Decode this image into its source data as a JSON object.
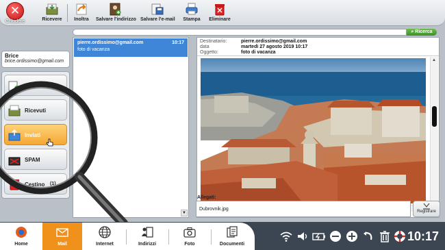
{
  "toolbar": {
    "close_label": "Chiudere",
    "buttons": [
      {
        "label": "Ricevere"
      },
      {
        "label": "Inoltra"
      },
      {
        "label": "Salvare l'indirizzo"
      },
      {
        "label": "Salvare l'e-mail"
      },
      {
        "label": "Stampa"
      },
      {
        "label": "Eliminare"
      }
    ]
  },
  "search": {
    "button_label": "Ricerca"
  },
  "user": {
    "name": "Brice",
    "email": "brice.ordissimo@gmail.com"
  },
  "folders": [
    {
      "label": "Scrivere",
      "icon": "compose-icon"
    },
    {
      "label": "Ricevuti",
      "icon": "inbox-icon"
    },
    {
      "label": "Inviati",
      "icon": "sent-icon"
    },
    {
      "label": "SPAM",
      "icon": "spam-icon"
    },
    {
      "label": "Cestino",
      "icon": "trash-icon",
      "count": "(1)"
    }
  ],
  "active_folder": "Inviati",
  "message_list": [
    {
      "from": "pierre.ordissimo@gmail.com",
      "time": "10:17",
      "subject": "foto di vacanza"
    }
  ],
  "message": {
    "to_label": "Destinatario:",
    "to": "pierre.ordissimo@gmail.com",
    "date_label": "data",
    "date": "martedì 27 agosto 2019 10:17",
    "subject_label": "Oggetto:",
    "subject": "foto di vacanza"
  },
  "attachments": {
    "label": "Allegati:",
    "file": "Dubrovnik.jpg",
    "save_label": "Registrare"
  },
  "dock": [
    {
      "label": "Home",
      "icon": "home-icon"
    },
    {
      "label": "Mail",
      "icon": "mail-icon"
    },
    {
      "label": "Internet",
      "icon": "globe-icon"
    },
    {
      "label": "Indirizzi",
      "icon": "contacts-icon"
    },
    {
      "label": "Foto",
      "icon": "camera-icon"
    },
    {
      "label": "Documenti",
      "icon": "documents-icon"
    }
  ],
  "active_dock": "Mail",
  "clock": "10:17",
  "colors": {
    "accent_orange": "#f0911c",
    "selection_blue": "#3f86d8",
    "search_green": "#4aa32e",
    "dock_bg": "#3c4652"
  }
}
